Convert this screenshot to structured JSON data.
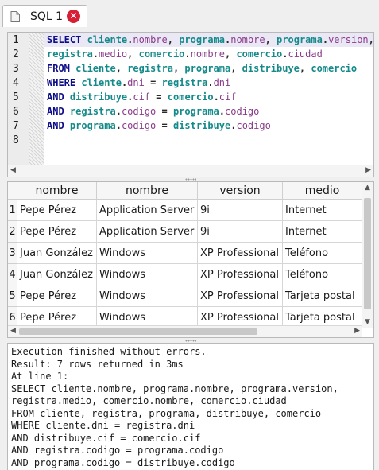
{
  "tab": {
    "title": "SQL 1",
    "close_icon": "close-icon",
    "file_icon": "sql-file-icon"
  },
  "editor": {
    "line_numbers": [
      "1",
      "2",
      "3",
      "4",
      "5",
      "6",
      "7",
      "8"
    ],
    "lines": [
      [
        [
          "SELECT ",
          "kw"
        ],
        [
          "cliente",
          "tbl"
        ],
        [
          ".",
          "op"
        ],
        [
          "nombre",
          "fld"
        ],
        [
          ", ",
          "op"
        ],
        [
          "programa",
          "tbl"
        ],
        [
          ".",
          "op"
        ],
        [
          "nombre",
          "fld"
        ],
        [
          ", ",
          "op"
        ],
        [
          "programa",
          "tbl"
        ],
        [
          ".",
          "op"
        ],
        [
          "version",
          "fld"
        ],
        [
          ",",
          "op"
        ]
      ],
      [
        [
          "registra",
          "tbl"
        ],
        [
          ".",
          "op"
        ],
        [
          "medio",
          "fld"
        ],
        [
          ", ",
          "op"
        ],
        [
          "comercio",
          "tbl"
        ],
        [
          ".",
          "op"
        ],
        [
          "nombre",
          "fld"
        ],
        [
          ", ",
          "op"
        ],
        [
          "comercio",
          "tbl"
        ],
        [
          ".",
          "op"
        ],
        [
          "ciudad",
          "fld"
        ]
      ],
      [
        [
          "FROM ",
          "kw"
        ],
        [
          "cliente",
          "tbl"
        ],
        [
          ", ",
          "op"
        ],
        [
          "registra",
          "tbl"
        ],
        [
          ", ",
          "op"
        ],
        [
          "programa",
          "tbl"
        ],
        [
          ", ",
          "op"
        ],
        [
          "distribuye",
          "tbl"
        ],
        [
          ", ",
          "op"
        ],
        [
          "comercio",
          "tbl"
        ]
      ],
      [
        [
          "WHERE ",
          "kw"
        ],
        [
          "cliente",
          "tbl"
        ],
        [
          ".",
          "op"
        ],
        [
          "dni",
          "fld"
        ],
        [
          " = ",
          "op"
        ],
        [
          "registra",
          "tbl"
        ],
        [
          ".",
          "op"
        ],
        [
          "dni",
          "fld"
        ]
      ],
      [
        [
          "AND ",
          "kw"
        ],
        [
          "distribuye",
          "tbl"
        ],
        [
          ".",
          "op"
        ],
        [
          "cif",
          "fld"
        ],
        [
          " = ",
          "op"
        ],
        [
          "comercio",
          "tbl"
        ],
        [
          ".",
          "op"
        ],
        [
          "cif",
          "fld"
        ]
      ],
      [
        [
          "AND ",
          "kw"
        ],
        [
          "registra",
          "tbl"
        ],
        [
          ".",
          "op"
        ],
        [
          "codigo",
          "fld"
        ],
        [
          " = ",
          "op"
        ],
        [
          "programa",
          "tbl"
        ],
        [
          ".",
          "op"
        ],
        [
          "codigo",
          "fld"
        ]
      ],
      [
        [
          "AND ",
          "kw"
        ],
        [
          "programa",
          "tbl"
        ],
        [
          ".",
          "op"
        ],
        [
          "codigo",
          "fld"
        ],
        [
          " = ",
          "op"
        ],
        [
          "distribuye",
          "tbl"
        ],
        [
          ".",
          "op"
        ],
        [
          "codigo",
          "fld"
        ]
      ],
      []
    ]
  },
  "results": {
    "columns": [
      "nombre",
      "nombre",
      "version",
      "medio"
    ],
    "rows": [
      {
        "n": "1",
        "cells": [
          "Pepe Pérez",
          "Application Server",
          "9i",
          "Internet"
        ]
      },
      {
        "n": "2",
        "cells": [
          "Pepe Pérez",
          "Application Server",
          "9i",
          "Internet"
        ]
      },
      {
        "n": "3",
        "cells": [
          "Juan González",
          "Windows",
          "XP Professional",
          "Teléfono"
        ]
      },
      {
        "n": "4",
        "cells": [
          "Juan González",
          "Windows",
          "XP Professional",
          "Teléfono"
        ]
      },
      {
        "n": "5",
        "cells": [
          "Pepe Pérez",
          "Windows",
          "XP Professional",
          "Tarjeta postal"
        ]
      },
      {
        "n": "6",
        "cells": [
          "Pepe Pérez",
          "Windows",
          "XP Professional",
          "Tarjeta postal"
        ]
      }
    ]
  },
  "messages": [
    "Execution finished without errors.",
    "Result: 7 rows returned in 3ms",
    "At line 1:",
    "SELECT cliente.nombre, programa.nombre, programa.version,",
    "registra.medio, comercio.nombre, comercio.ciudad",
    "FROM cliente, registra, programa, distribuye, comercio",
    "WHERE cliente.dni = registra.dni",
    "AND distribuye.cif = comercio.cif",
    "AND registra.codigo = programa.codigo",
    "AND programa.codigo = distribuye.codigo"
  ],
  "colors": {
    "accent_close": "#d71f36",
    "keyword": "#0d0d8a",
    "table": "#148a8a",
    "field": "#8a3c8a"
  }
}
